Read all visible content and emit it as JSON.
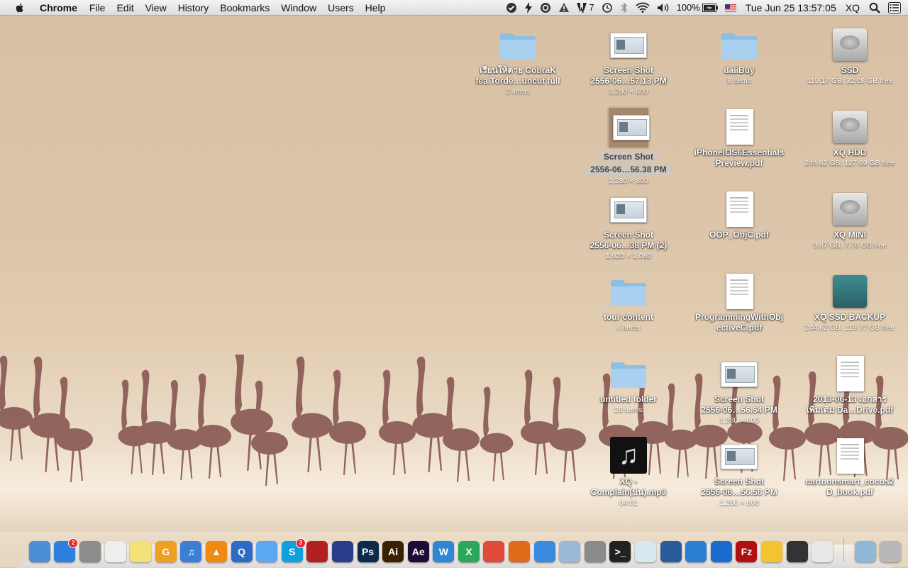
{
  "menubar": {
    "app_name": "Chrome",
    "items": [
      "File",
      "Edit",
      "View",
      "History",
      "Bookmarks",
      "Window",
      "Users",
      "Help"
    ],
    "status": {
      "adobe_count": "7",
      "battery": "100%",
      "datetime": "Tue Jun 25  13:57:05",
      "user": "XQ"
    }
  },
  "desktop": {
    "icons": [
      {
        "name": "เรียนให้ตาย CobraK",
        "name2": "fea.Torde…uncut full",
        "sub": "2 items",
        "type": "folder"
      },
      {
        "name": "Screen Shot",
        "name2": "2556-06…57.13 PM",
        "sub": "1,280 × 800",
        "type": "screenshot"
      },
      {
        "name": "daiiBuy",
        "name2": "",
        "sub": "8 items",
        "type": "folder"
      },
      {
        "name": "SSD",
        "name2": "",
        "sub": "119.17 GB, 32.08 GB free",
        "type": "hdd"
      },
      {
        "name": "Screen Shot",
        "name2": "2556-06…56.38 PM",
        "sub": "1,280 × 800",
        "type": "screenshot"
      },
      {
        "name": "iPhoneiOS6Essentials",
        "name2": "Preview.pdf",
        "sub": "",
        "type": "pdf"
      },
      {
        "name": "XQ HDD",
        "name2": "",
        "sub": "244.62 GB, 127.69 GB free",
        "type": "hdd"
      },
      {
        "name": "Screen Shot",
        "name2": "2556-06…38 PM (2)",
        "sub": "1,920 × 1,080",
        "type": "screenshot"
      },
      {
        "name": "OOP_ObjC.pdf",
        "name2": "",
        "sub": "",
        "type": "pdf"
      },
      {
        "name": "XQ MINI",
        "name2": "",
        "sub": "9.87 GB, 7.76 GB free",
        "type": "hdd"
      },
      {
        "name": "tour content",
        "name2": "",
        "sub": "6 items",
        "type": "folder"
      },
      {
        "name": "ProgrammingWithObj",
        "name2": "ectiveC.pdf",
        "sub": "",
        "type": "pdf"
      },
      {
        "name": "XQ SSD BACKUP",
        "name2": "",
        "sub": "244.62 GB, 119.77 GB free",
        "type": "timemachine"
      },
      {
        "name": "untitled folder",
        "name2": "",
        "sub": "28 items",
        "type": "folder"
      },
      {
        "name": "Screen Shot",
        "name2": "2556-06…56.54 PM",
        "sub": "1,280 × 800",
        "type": "screenshot"
      },
      {
        "name": "2013-06-13 เอกสาร",
        "name2": "เพิ่มเติม Da…Drive.pdf",
        "sub": "",
        "type": "pdf"
      },
      {
        "name": "XQ -",
        "name2": "Complain(บ่น).mp3",
        "sub": "04:01",
        "type": "music"
      },
      {
        "name": "Screen Shot",
        "name2": "2556-06…56.58 PM",
        "sub": "1,280 × 800",
        "type": "screenshot"
      },
      {
        "name": "cartoonsmart_cocos2",
        "name2": "D_book.pdf",
        "sub": "",
        "type": "pdf"
      }
    ]
  },
  "dock": {
    "apps": [
      {
        "icon": "finder-icon",
        "color": "#4a8fd8",
        "label": ""
      },
      {
        "icon": "app-store-icon",
        "color": "#2f7fe0",
        "label": "",
        "badge": "2"
      },
      {
        "icon": "system-preferences-icon",
        "color": "#8c8c8c",
        "label": ""
      },
      {
        "icon": "textedit-icon",
        "color": "#eeeeee",
        "label": ""
      },
      {
        "icon": "stickies-icon",
        "color": "#f3e27a",
        "label": ""
      },
      {
        "icon": "garageband-g-icon",
        "color": "#f0a020",
        "label": "G"
      },
      {
        "icon": "itunes-icon",
        "color": "#3a7fd5",
        "label": "♫"
      },
      {
        "icon": "vlc-icon",
        "color": "#f08a10",
        "label": "▲"
      },
      {
        "icon": "quicktime-icon",
        "color": "#2d6cc4",
        "label": "Q"
      },
      {
        "icon": "messages-icon",
        "color": "#5aa8f0",
        "label": ""
      },
      {
        "icon": "skype-icon",
        "color": "#10a0e0",
        "label": "S",
        "badge": "3"
      },
      {
        "icon": "photo-booth-icon",
        "color": "#b02020",
        "label": ""
      },
      {
        "icon": "audacity-icon",
        "color": "#2a3c8a",
        "label": ""
      },
      {
        "icon": "photoshop-icon",
        "color": "#0c2b4b",
        "label": "Ps"
      },
      {
        "icon": "illustrator-icon",
        "color": "#3a2200",
        "label": "Ai"
      },
      {
        "icon": "after-effects-icon",
        "color": "#1f0b3a",
        "label": "Ae"
      },
      {
        "icon": "word-w-icon",
        "color": "#2e86d6",
        "label": "W"
      },
      {
        "icon": "excel-x-icon",
        "color": "#2aa85a",
        "label": "X"
      },
      {
        "icon": "chrome-icon",
        "color": "#e04a3a",
        "label": ""
      },
      {
        "icon": "firefox-icon",
        "color": "#e06a1a",
        "label": ""
      },
      {
        "icon": "safari-icon",
        "color": "#3a8ae0",
        "label": ""
      },
      {
        "icon": "virtualbox-box-icon",
        "color": "#9ab8d8",
        "label": ""
      },
      {
        "icon": "network-utility-icon",
        "color": "#8a8a8a",
        "label": ""
      },
      {
        "icon": "terminal-icon",
        "color": "#222222",
        "label": ">_"
      },
      {
        "icon": "mysql-workbench-icon",
        "color": "#d8e8f0",
        "label": ""
      },
      {
        "icon": "virtualbox-icon",
        "color": "#2a5c9a",
        "label": ""
      },
      {
        "icon": "dropbox-icon",
        "color": "#2a7fd5",
        "label": ""
      },
      {
        "icon": "teamviewer-icon",
        "color": "#1a6ad0",
        "label": ""
      },
      {
        "icon": "filezilla-icon",
        "color": "#b01010",
        "label": "Fz"
      },
      {
        "icon": "google-drive-icon",
        "color": "#f4c430",
        "label": ""
      },
      {
        "icon": "activity-monitor-icon",
        "color": "#333333",
        "label": ""
      },
      {
        "icon": "preview-window-icon",
        "color": "#e8e8e8",
        "label": ""
      }
    ],
    "right": [
      {
        "icon": "applications-folder-icon",
        "color": "#8fb8d8"
      },
      {
        "icon": "trash-icon",
        "color": "#b8b8b8"
      }
    ]
  }
}
